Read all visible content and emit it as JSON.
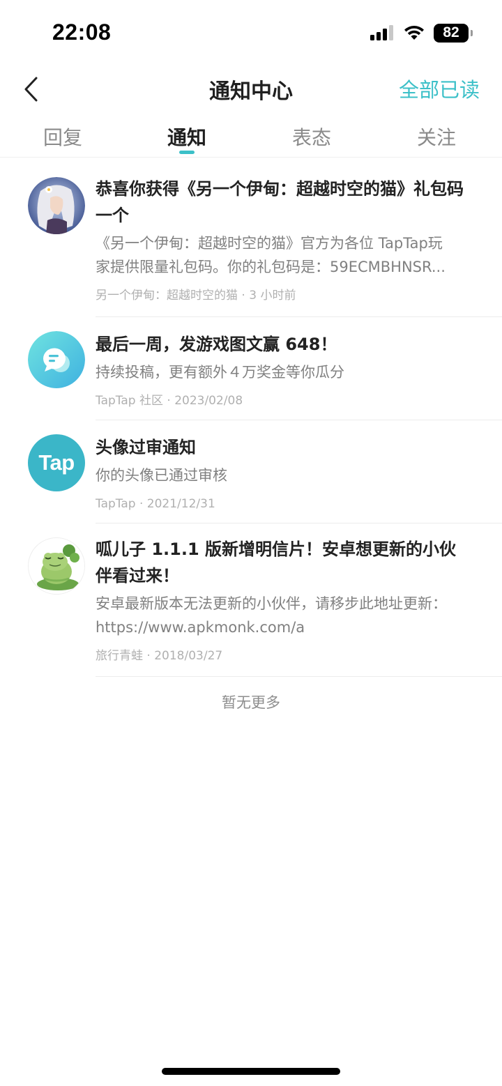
{
  "status_bar": {
    "time": "22:08",
    "battery": "82"
  },
  "nav": {
    "title": "通知中心",
    "mark_all_read": "全部已读"
  },
  "tabs": [
    {
      "label": "回复",
      "active": false
    },
    {
      "label": "通知",
      "active": true
    },
    {
      "label": "表态",
      "active": false
    },
    {
      "label": "关注",
      "active": false
    }
  ],
  "notifications": [
    {
      "avatar": "game-character-avatar",
      "title": "恭喜你获得《另一个伊甸：超越时空的猫》礼包码一个",
      "body_line1": "《另一个伊甸：超越时空的猫》官方为各位 TapTap玩",
      "body_line2": "家提供限量礼包码。你的礼包码是：59ECMBHNSR...",
      "source": "另一个伊甸：超越时空的猫",
      "time": "3 小时前"
    },
    {
      "avatar": "chat-bubble-icon",
      "title": "最后一周，发游戏图文赢 648！",
      "body_line1": "持续投稿，更有额外４万奖金等你瓜分",
      "body_line2": "",
      "source": "TapTap 社区",
      "time": "2023/02/08"
    },
    {
      "avatar": "taptap-logo",
      "logo_text": "Tap",
      "title": "头像过审通知",
      "body_line1": "你的头像已通过审核",
      "body_line2": "",
      "source": "TapTap",
      "time": "2021/12/31"
    },
    {
      "avatar": "frog-avatar",
      "title": "呱儿子 1.1.1 版新增明信片！安卓想更新的小伙伴看过来！",
      "body_line1": "安卓最新版本无法更新的小伙伴，请移步此地址更新：",
      "body_line2": "https://www.apkmonk.com/a",
      "source": "旅行青蛙",
      "time": "2018/03/27"
    }
  ],
  "footer": {
    "no_more": "暂无更多"
  },
  "colors": {
    "accent": "#3cc0c8",
    "text": "#222222",
    "secondary": "#808080",
    "meta": "#b0b0b0"
  }
}
